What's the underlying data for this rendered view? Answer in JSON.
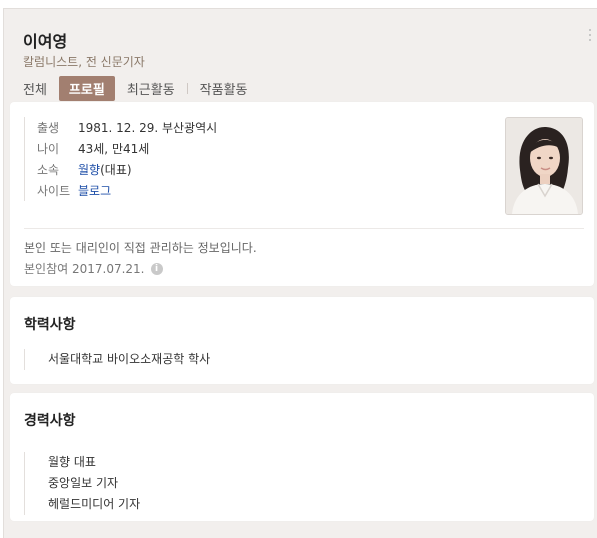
{
  "header": {
    "name": "이여영",
    "subtitle": "칼럼니스트, 전 신문기자"
  },
  "tabs": [
    {
      "label": "전체",
      "active": false
    },
    {
      "label": "프로필",
      "active": true
    },
    {
      "label": "최근활동",
      "active": false
    },
    {
      "label": "작품활동",
      "active": false
    }
  ],
  "profile": {
    "rows": [
      {
        "label": "출생",
        "value": "1981. 12. 29. 부산광역시"
      },
      {
        "label": "나이",
        "value": "43세, 만41세"
      },
      {
        "label": "소속",
        "value_link": "월향",
        "value_suffix": "(대표)"
      },
      {
        "label": "사이트",
        "value_link": "블로그"
      }
    ],
    "note": "본인 또는 대리인이 직접 관리하는 정보입니다.",
    "date_text": "본인참여 2017.07.21."
  },
  "education": {
    "title": "학력사항",
    "items": [
      "서울대학교 바이오소재공학 학사"
    ]
  },
  "career": {
    "title": "경력사항",
    "items": [
      "월향 대표",
      "중앙일보 기자",
      "헤럴드미디어 기자"
    ]
  },
  "colors": {
    "active_tab_bg": "#a27f70",
    "link": "#1f4fa8",
    "page_bg": "#f2efed"
  }
}
